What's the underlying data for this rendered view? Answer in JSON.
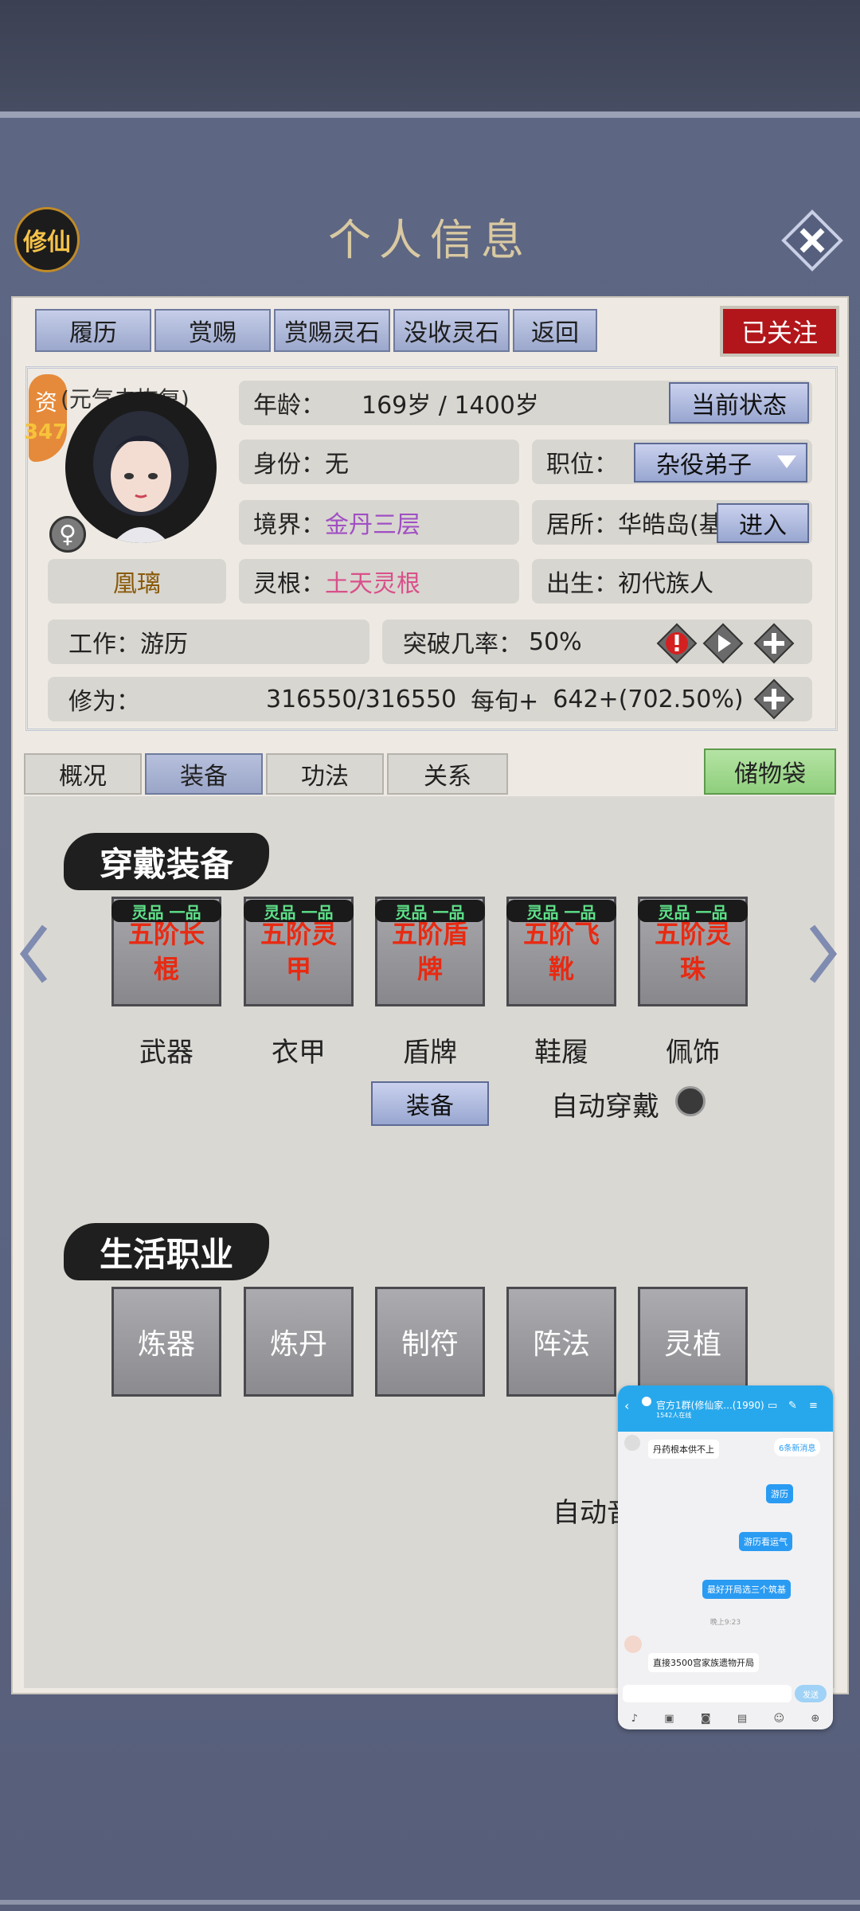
{
  "header": {
    "logo": "修仙",
    "title": "个人信息",
    "close_icon": "close-x-icon"
  },
  "top_tabs": [
    "履历",
    "赏赐",
    "赏赐灵石",
    "没收灵石",
    "返回"
  ],
  "follow_badge": "已关注",
  "profile": {
    "talent_label": "资",
    "talent_value": "347",
    "status_note": "(元气未恢复)",
    "gender_icon": "female-icon",
    "name": "凰璃",
    "age_label": "年龄：",
    "age_value": "169岁 / 1400岁",
    "current_state_btn": "当前状态",
    "identity_label": "身份：",
    "identity_value": "无",
    "position_label": "职位：",
    "position_value": "杂役弟子",
    "realm_label": "境界：",
    "realm_value": "金丹三层",
    "residence_label": "居所：",
    "residence_value": "华皓岛(基",
    "enter_btn": "进入",
    "root_label": "灵根：",
    "root_value": "土天灵根",
    "birth_label": "出生：",
    "birth_value": "初代族人",
    "work_label": "工作：",
    "work_value": "游历",
    "breakthrough_label": "突破几率：",
    "breakthrough_value": "50%",
    "cultivation_label": "修为：",
    "cultivation_value": "316550/316550",
    "per_turn_label": "每旬+",
    "per_turn_value": "642+(702.50%)"
  },
  "section_tabs": [
    "概况",
    "装备",
    "功法",
    "关系"
  ],
  "storage_btn": "储物袋",
  "equipment": {
    "heading": "穿戴装备",
    "quality": "灵品 一品",
    "slots": [
      {
        "item_l1": "五阶长",
        "item_l2": "棍",
        "label": "武器"
      },
      {
        "item_l1": "五阶灵",
        "item_l2": "甲",
        "label": "衣甲"
      },
      {
        "item_l1": "五阶盾",
        "item_l2": "牌",
        "label": "盾牌"
      },
      {
        "item_l1": "五阶飞",
        "item_l2": "靴",
        "label": "鞋履"
      },
      {
        "item_l1": "五阶灵",
        "item_l2": "珠",
        "label": "佩饰"
      }
    ],
    "equip_btn": "装备",
    "auto_wear": "自动穿戴"
  },
  "life": {
    "heading": "生活职业",
    "jobs": [
      "炼器",
      "炼丹",
      "制符",
      "阵法",
      "灵植"
    ],
    "auto_label": "自动音"
  },
  "chat": {
    "title": "官方1群(修仙家...(1990)",
    "subtitle": "1542人在线",
    "new_msgs": "6条新消息",
    "msgs": [
      {
        "side": "l",
        "text": "丹药根本供不上"
      },
      {
        "side": "r",
        "text": "游历"
      },
      {
        "side": "r",
        "text": "游历看运气"
      },
      {
        "side": "r",
        "text": "最好开局选三个筑基"
      },
      {
        "side": "t",
        "text": "晚上9:23"
      },
      {
        "side": "l",
        "text": "直接3500宫家族遗物开局"
      }
    ],
    "send": "发送"
  },
  "colors": {
    "realm": "#a04fc4",
    "root": "#d9508a",
    "follow": "#b2161b",
    "slot_text": "#e82a12",
    "quality": "#5fe38a"
  }
}
